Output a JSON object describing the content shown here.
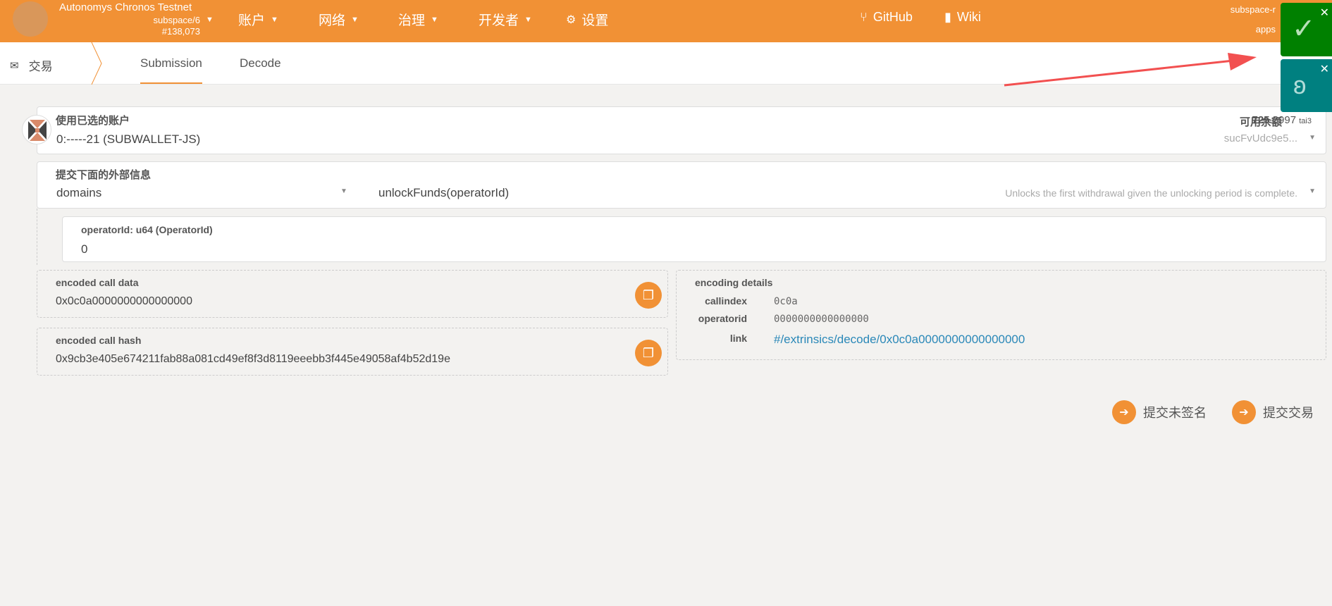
{
  "header": {
    "chain_name": "Autonomys Chronos Testnet",
    "spec": "subspace/6",
    "block": "#138,073",
    "nav": [
      {
        "label": "账户"
      },
      {
        "label": "网络"
      },
      {
        "label": "治理"
      },
      {
        "label": "开发者"
      },
      {
        "label": "设置"
      }
    ],
    "links": [
      {
        "label": "GitHub",
        "icon": "git-branch-icon"
      },
      {
        "label": "Wiki",
        "icon": "book-icon"
      }
    ],
    "right_top": "subspace-r",
    "right_bottom": "apps"
  },
  "subnav": {
    "section": "交易",
    "tabs": [
      {
        "label": "Submission",
        "active": true
      },
      {
        "label": "Decode",
        "active": false
      }
    ]
  },
  "account": {
    "label": "使用已选的账户",
    "value": "0:-----21 (SUBWALLET-JS)",
    "balance_label": "可用余额",
    "balance_int": "725",
    "balance_dec": ".3997",
    "balance_unit": "tai3",
    "address": "sucFvUdc9e5..."
  },
  "extrinsic": {
    "label": "提交下面的外部信息",
    "pallet": "domains",
    "method": "unlockFunds(operatorId)",
    "description": "Unlocks the first withdrawal given the unlocking period is complete."
  },
  "param": {
    "label": "operatorId: u64 (OperatorId)",
    "value": "0"
  },
  "call_data": {
    "label": "encoded call data",
    "value": "0x0c0a0000000000000000"
  },
  "call_hash": {
    "label": "encoded call hash",
    "value": "0x9cb3e405e674211fab88a081cd49ef8f3d8119eeebb3f445e49058af4b52d19e"
  },
  "encoding": {
    "label": "encoding details",
    "rows": [
      {
        "k": "callindex",
        "v": "0c0a"
      },
      {
        "k": "operatorid",
        "v": "0000000000000000"
      },
      {
        "k": "link",
        "v": "#/extrinsics/decode/0x0c0a0000000000000000"
      }
    ]
  },
  "actions": {
    "unsigned": "提交未签名",
    "submit": "提交交易"
  },
  "colors": {
    "accent": "#f19135",
    "link": "#2a88b8",
    "green": "#008000",
    "teal": "#008080",
    "arrow": "#f25050"
  }
}
